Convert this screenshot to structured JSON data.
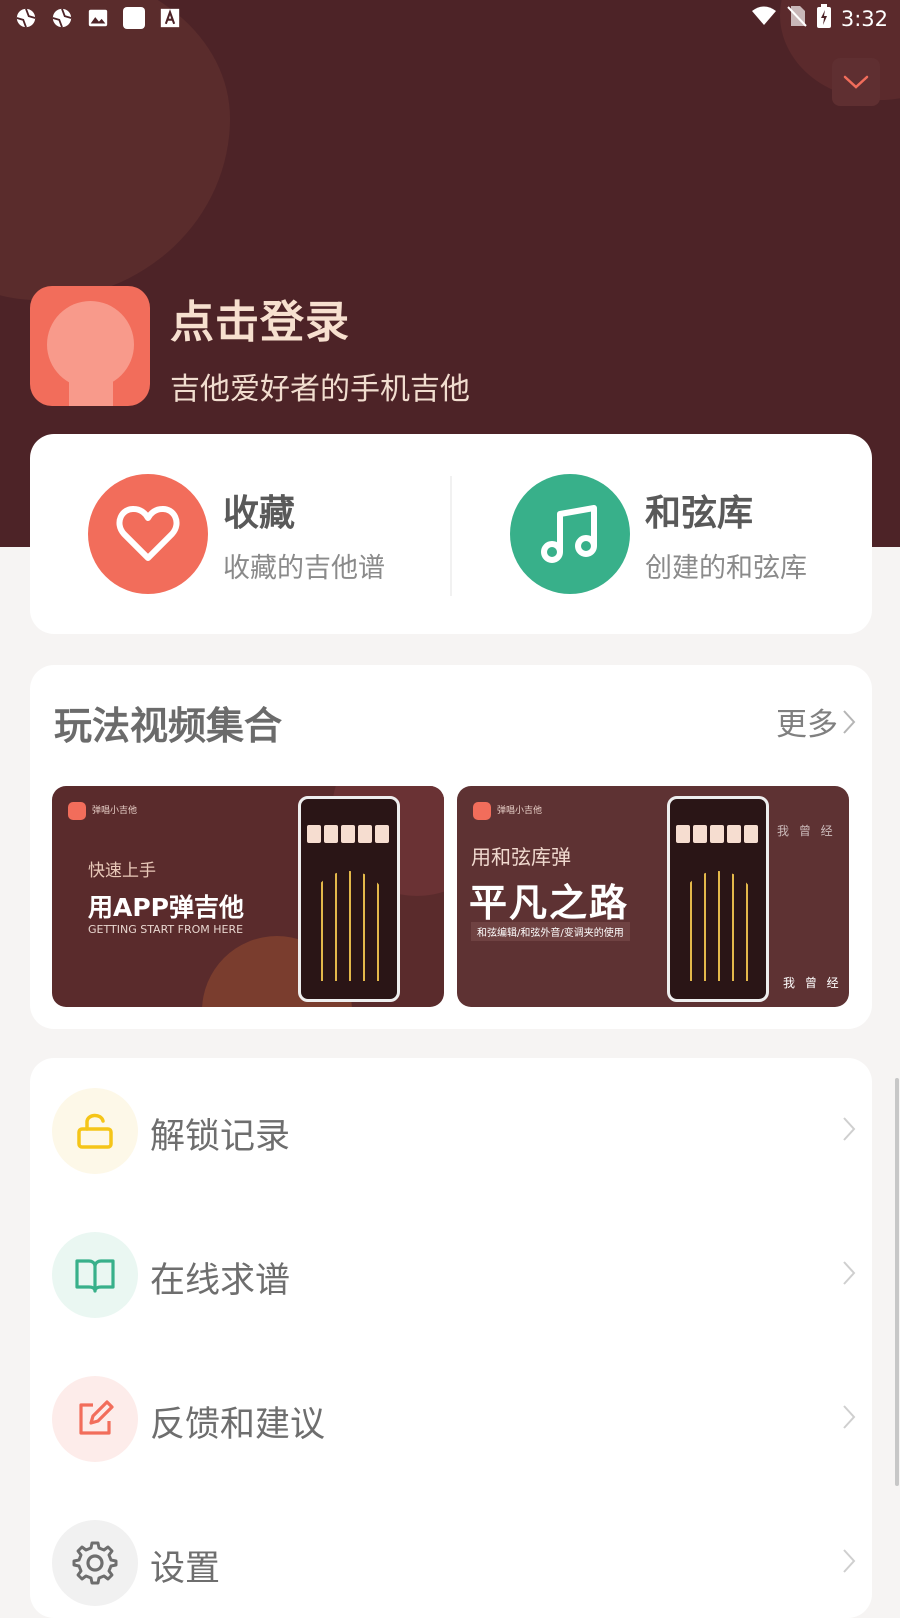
{
  "status_bar": {
    "time": "3:32",
    "left_icons": [
      "aperture-icon",
      "aperture-icon",
      "image-icon",
      "square-icon",
      "font-icon"
    ],
    "right_icons": [
      "wifi-icon",
      "no-sim-icon",
      "battery-charging-icon"
    ]
  },
  "profile": {
    "login_title": "点击登录",
    "subtitle": "吉他爱好者的手机吉他"
  },
  "quick_actions": [
    {
      "title": "收藏",
      "subtitle": "收藏的吉他谱",
      "icon": "heart-icon",
      "color": "#f26d5b"
    },
    {
      "title": "和弦库",
      "subtitle": "创建的和弦库",
      "icon": "music-note-icon",
      "color": "#38b08a"
    }
  ],
  "videos": {
    "section_title": "玩法视频集合",
    "more_label": "更多",
    "items": [
      {
        "app_tag": "弹唱小吉他",
        "small": "快速上手",
        "title": "用APP弹吉他",
        "english": "GETTING START FROM HERE"
      },
      {
        "app_tag": "弹唱小吉他",
        "small": "用和弦库弹",
        "title": "平凡之路",
        "tag": "和弦编辑/和弦外音/变调夹的使用",
        "side1": "我 曾 经",
        "side2": "我 曾 经"
      }
    ]
  },
  "menu": [
    {
      "label": "解锁记录",
      "icon": "unlock-icon",
      "color": "#f5c518",
      "bg": "#fdf8e8"
    },
    {
      "label": "在线求谱",
      "icon": "book-icon",
      "color": "#38b08a",
      "bg": "#eaf7f2"
    },
    {
      "label": "反馈和建议",
      "icon": "edit-icon",
      "color": "#f26d5b",
      "bg": "#fdecea"
    },
    {
      "label": "设置",
      "icon": "gear-icon",
      "color": "#6e6e6e",
      "bg": "#f1f1f1"
    }
  ]
}
